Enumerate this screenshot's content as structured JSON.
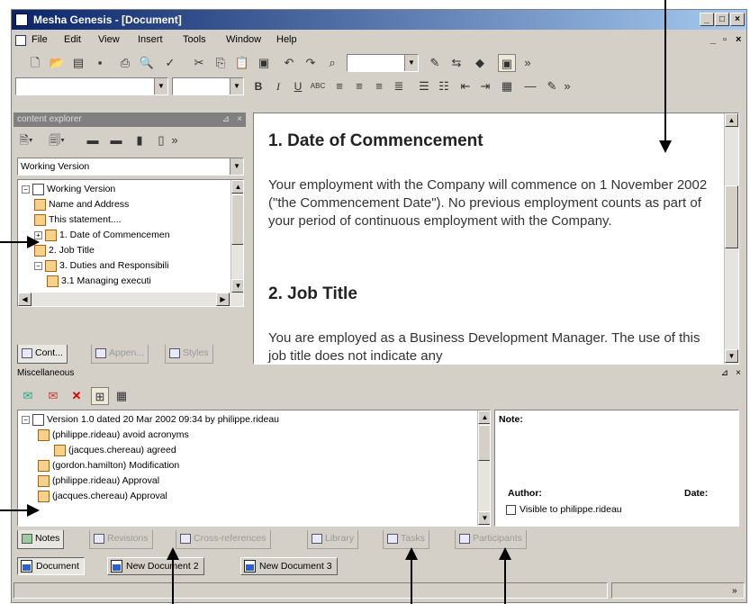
{
  "window": {
    "title": "Mesha Genesis - [Document]"
  },
  "menu": [
    "File",
    "Edit",
    "View",
    "Insert",
    "Tools",
    "Window",
    "Help"
  ],
  "toolbar2": {
    "bold": "B",
    "italic": "I",
    "underline": "U",
    "strike": "ABC"
  },
  "explorer": {
    "title": "content explorer",
    "version_select": "Working Version",
    "tree": [
      {
        "label": "Working Version",
        "indent": 0,
        "expander": "−"
      },
      {
        "label": "Name and Address",
        "indent": 1,
        "expander": ""
      },
      {
        "label": "This statement....",
        "indent": 1,
        "expander": ""
      },
      {
        "label": "1. Date of Commencemen",
        "indent": 1,
        "expander": "+"
      },
      {
        "label": "2. Job Title",
        "indent": 1,
        "expander": ""
      },
      {
        "label": "3. Duties and Responsibili",
        "indent": 1,
        "expander": "−"
      },
      {
        "label": "3.1 Managing executi",
        "indent": 2,
        "expander": ""
      }
    ],
    "tabs": [
      "Cont...",
      "Appen...",
      "Styles"
    ]
  },
  "document": {
    "heading1": "1. Date of Commencement",
    "para1": "Your employment with the Company will commence on 1 November 2002 (\"the Commencement Date\"). No previous employment counts as part of your period of continuous employment with the Company.",
    "heading2": "2. Job Title",
    "para2": "You are employed as a Business Development Manager. The use of this job title does not indicate any"
  },
  "misc": {
    "title": "Miscellaneous",
    "tree": [
      {
        "label": "Version 1.0 dated 20 Mar 2002 09:34 by philippe.rideau",
        "indent": 0
      },
      {
        "label": "(philippe.rideau) avoid acronyms",
        "indent": 1
      },
      {
        "label": "(jacques.chereau) agreed",
        "indent": 2
      },
      {
        "label": "(gordon.hamilton) Modification",
        "indent": 1
      },
      {
        "label": "(philippe.rideau) Approval",
        "indent": 1
      },
      {
        "label": "(jacques.chereau) Approval",
        "indent": 1
      }
    ],
    "note_label": "Note:",
    "author_label": "Author:",
    "date_label": "Date:",
    "visible_label": "Visible to philippe.rideau"
  },
  "bottom_tabs": [
    "Notes",
    "Revisions",
    "Cross-references",
    "Library",
    "Tasks",
    "Participants"
  ],
  "doc_tabs": [
    "Document",
    "New Document 2",
    "New Document 3"
  ],
  "colors": {
    "title_start": "#0a246a",
    "title_end": "#a6caf0",
    "face": "#d4d0c8"
  }
}
